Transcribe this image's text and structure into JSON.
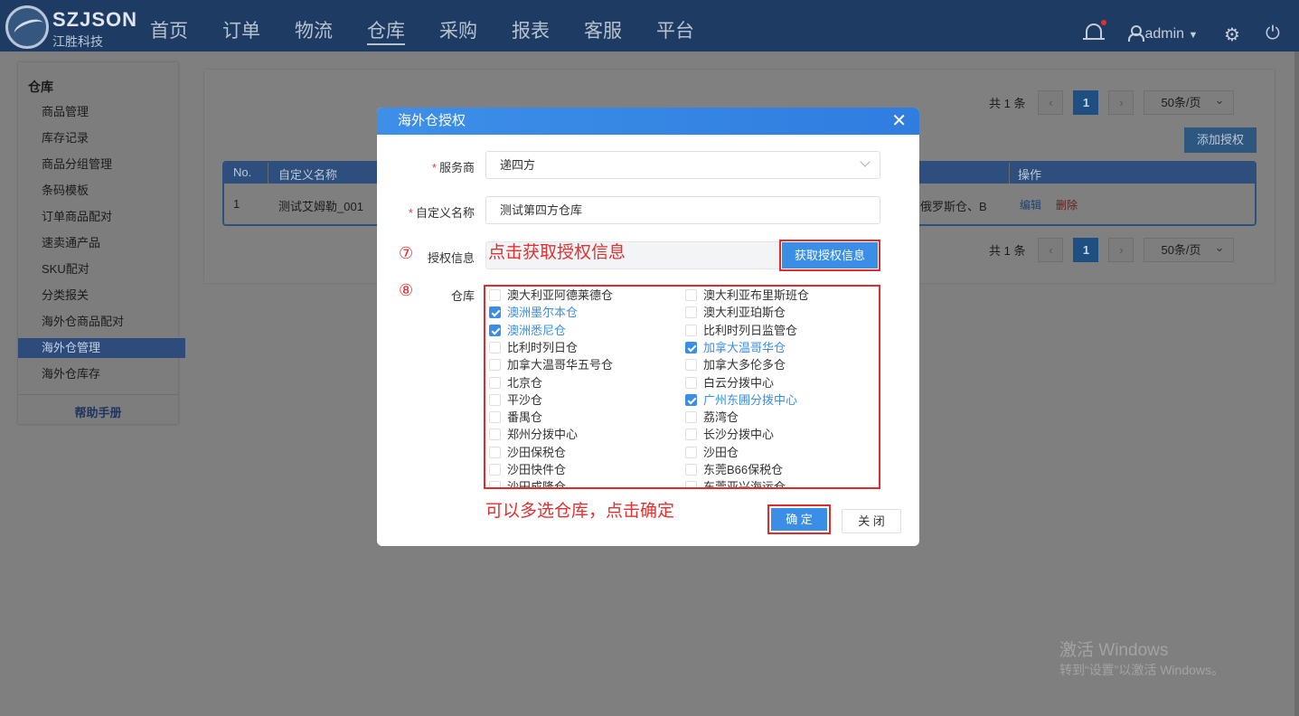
{
  "app": {
    "logo_text": "SZJSON",
    "logo_sub": "江胜科技",
    "nav": [
      "首页",
      "订单",
      "物流",
      "仓库",
      "采购",
      "报表",
      "客服",
      "平台"
    ],
    "active_nav": "仓库",
    "user": "admin",
    "icons": {
      "bell": "bell-icon",
      "user": "user-icon",
      "settings": "gear-icon",
      "power": "power-icon"
    }
  },
  "sidebar": {
    "title": "仓库",
    "items": [
      "商品管理",
      "库存记录",
      "商品分组管理",
      "条码模板",
      "订单商品配对",
      "速卖通产品",
      "SKU配对",
      "分类报关",
      "海外仓商品配对",
      "海外仓管理",
      "海外仓库存"
    ],
    "active": "海外仓管理",
    "help": "帮助手册"
  },
  "panel": {
    "total_text": "共 1 条",
    "page": "1",
    "prev": "‹",
    "next": "›",
    "page_size": "50条/页",
    "add_button": "添加授权",
    "table": {
      "headers": [
        "No.",
        "自定义名称",
        "操作"
      ],
      "rows": [
        {
          "no": "1",
          "name": "测试艾姆勒_001",
          "warehouses": "俄罗斯仓、B",
          "edit": "编辑",
          "delete": "删除"
        }
      ]
    }
  },
  "modal": {
    "title": "海外仓授权",
    "close": "✕",
    "provider_label": "服务商",
    "provider_value": "递四方",
    "name_label": "自定义名称",
    "name_value": "测试第四方仓库",
    "auth_label": "授权信息",
    "get_auth_button": "获取授权信息",
    "warehouse_label": "仓库",
    "warehouses_left": [
      {
        "name": "澳大利亚阿德莱德仓",
        "checked": false
      },
      {
        "name": "澳洲墨尔本仓",
        "checked": true
      },
      {
        "name": "澳洲悉尼仓",
        "checked": true
      },
      {
        "name": "比利时列日仓",
        "checked": false
      },
      {
        "name": "加拿大温哥华五号仓",
        "checked": false
      },
      {
        "name": "北京仓",
        "checked": false
      },
      {
        "name": "平沙仓",
        "checked": false
      },
      {
        "name": "番禺仓",
        "checked": false
      },
      {
        "name": "郑州分拨中心",
        "checked": false
      },
      {
        "name": "沙田保税仓",
        "checked": false
      },
      {
        "name": "沙田快件仓",
        "checked": false
      },
      {
        "name": "沙田成隆仓",
        "checked": false
      }
    ],
    "warehouses_right": [
      {
        "name": "澳大利亚布里斯班仓",
        "checked": false
      },
      {
        "name": "澳大利亚珀斯仓",
        "checked": false
      },
      {
        "name": "比利时列日监管仓",
        "checked": false
      },
      {
        "name": "加拿大温哥华仓",
        "checked": true
      },
      {
        "name": "加拿大多伦多仓",
        "checked": false
      },
      {
        "name": "白云分拨中心",
        "checked": false
      },
      {
        "name": "广州东圃分拨中心",
        "checked": true
      },
      {
        "name": "荔湾仓",
        "checked": false
      },
      {
        "name": "长沙分拨中心",
        "checked": false
      },
      {
        "name": "沙田仓",
        "checked": false
      },
      {
        "name": "东莞B66保税仓",
        "checked": false
      },
      {
        "name": "东莞亚兴海运仓",
        "checked": false
      }
    ],
    "ok_button": "确 定",
    "close_button": "关 闭"
  },
  "annotations": {
    "step7": "⑦",
    "step8": "⑧",
    "note_auth": "点击获取授权信息",
    "note_confirm": "可以多选仓库，点击确定"
  },
  "watermark": {
    "line1": "激活 Windows",
    "line2": "转到“设置”以激活 Windows。"
  }
}
